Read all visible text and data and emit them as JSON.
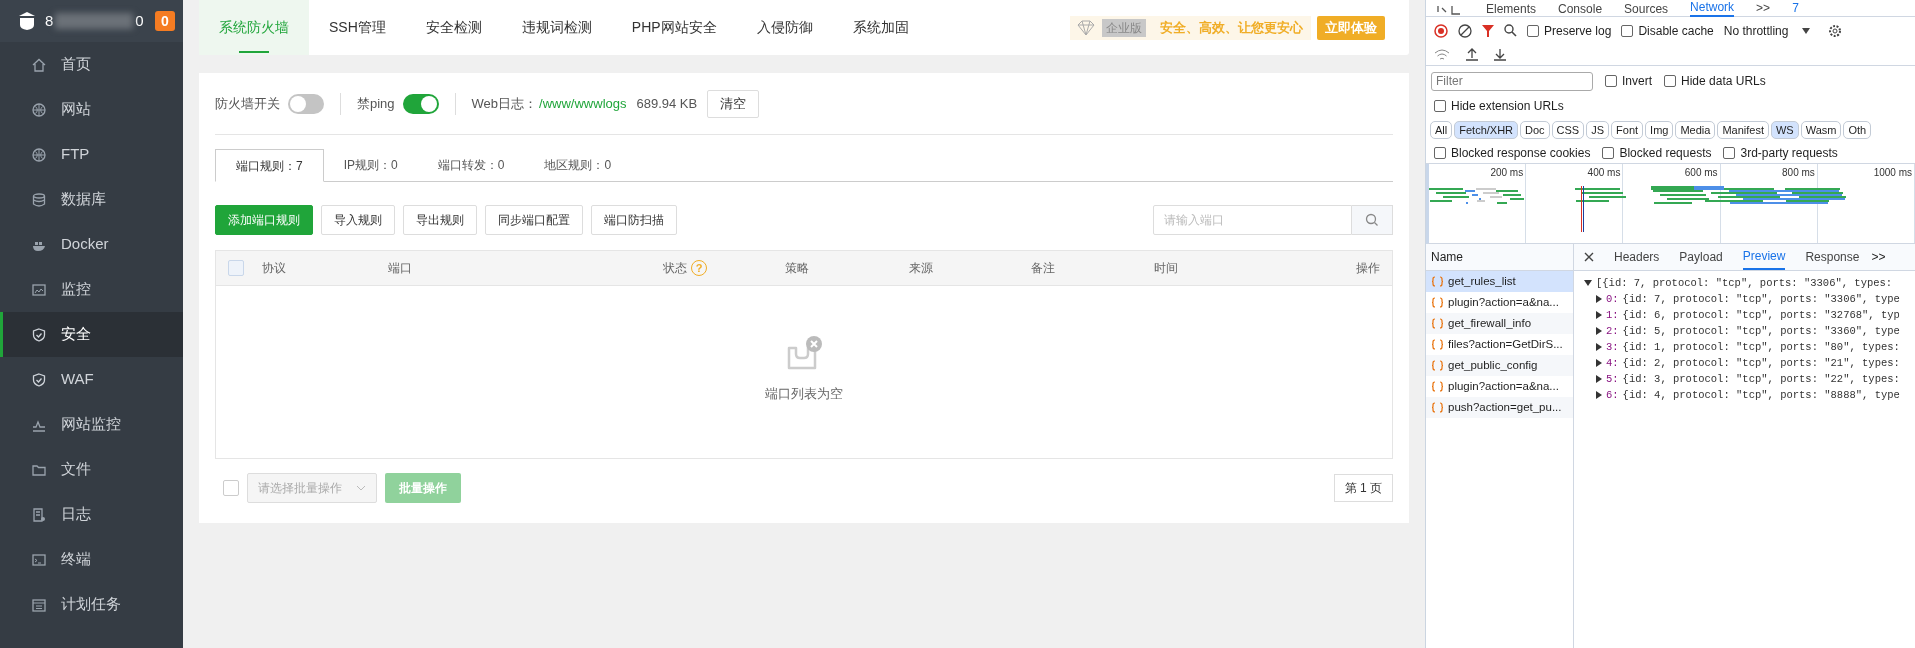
{
  "sidebar": {
    "user_start": "8",
    "user_end": "0",
    "badge": "0",
    "items": [
      {
        "label": "首页",
        "selected": false
      },
      {
        "label": "网站",
        "selected": false
      },
      {
        "label": "FTP",
        "selected": false
      },
      {
        "label": "数据库",
        "selected": false
      },
      {
        "label": "Docker",
        "selected": false
      },
      {
        "label": "监控",
        "selected": false
      },
      {
        "label": "安全",
        "selected": true
      },
      {
        "label": "WAF",
        "selected": false
      },
      {
        "label": "网站监控",
        "selected": false
      },
      {
        "label": "文件",
        "selected": false
      },
      {
        "label": "日志",
        "selected": false
      },
      {
        "label": "终端",
        "selected": false
      },
      {
        "label": "计划任务",
        "selected": false
      }
    ]
  },
  "top_tabs": [
    {
      "label": "系统防火墙",
      "selected": true
    },
    {
      "label": "SSH管理",
      "selected": false
    },
    {
      "label": "安全检测",
      "selected": false
    },
    {
      "label": "违规词检测",
      "selected": false
    },
    {
      "label": "PHP网站安全",
      "selected": false
    },
    {
      "label": "入侵防御",
      "selected": false
    },
    {
      "label": "系统加固",
      "selected": false
    }
  ],
  "promo": {
    "edition": "企业版",
    "slogan": "安全、高效、让您更安心",
    "button": "立即体验"
  },
  "firewall": {
    "switches": [
      {
        "label": "防火墙开关",
        "on": false
      },
      {
        "label": "禁ping",
        "on": true
      }
    ],
    "log_label": "Web日志：",
    "log_path": "/www/wwwlogs",
    "log_size": "689.94 KB",
    "clear_button": "清空"
  },
  "rule_tabs": [
    {
      "label": "端口规则：7",
      "selected": true
    },
    {
      "label": "IP规则：0",
      "selected": false
    },
    {
      "label": "端口转发：0",
      "selected": false
    },
    {
      "label": "地区规则：0",
      "selected": false
    }
  ],
  "toolbar_buttons": [
    {
      "label": "添加端口规则",
      "kind": "primary"
    },
    {
      "label": "导入规则",
      "kind": "default"
    },
    {
      "label": "导出规则",
      "kind": "default"
    },
    {
      "label": "同步端口配置",
      "kind": "default"
    },
    {
      "label": "端口防扫描",
      "kind": "default"
    }
  ],
  "search": {
    "placeholder": "请输入端口"
  },
  "table": {
    "select_all": false,
    "columns": [
      {
        "label": "协议"
      },
      {
        "label": "端口"
      },
      {
        "label": "状态",
        "help": "?"
      },
      {
        "label": "策略"
      },
      {
        "label": "来源"
      },
      {
        "label": "备注"
      },
      {
        "label": "时间"
      },
      {
        "label": "操作"
      }
    ],
    "empty_text": "端口列表为空"
  },
  "footer": {
    "select_all": false,
    "batch_placeholder": "请选择批量操作",
    "batch_button": "批量操作",
    "page": "第 1 页"
  },
  "devtools": {
    "tabs": [
      {
        "label": "Elements",
        "selected": false
      },
      {
        "label": "Console",
        "selected": false
      },
      {
        "label": "Sources",
        "selected": false
      },
      {
        "label": "Network",
        "selected": true
      }
    ],
    "more": ">>",
    "issues": "7",
    "checks": [
      {
        "label": "Preserve log",
        "checked": false
      },
      {
        "label": "Disable cache",
        "checked": false
      }
    ],
    "throttling": "No throttling",
    "filter_placeholder": "Filter",
    "filter_checks": [
      {
        "label": "Invert",
        "checked": false
      },
      {
        "label": "Hide data URLs",
        "checked": false
      }
    ],
    "ext_check": {
      "label": "Hide extension URLs",
      "checked": false
    },
    "type_filters": [
      {
        "label": "All",
        "selected": false
      },
      {
        "label": "Fetch/XHR",
        "selected": true
      },
      {
        "label": "Doc",
        "selected": false
      },
      {
        "label": "CSS",
        "selected": false
      },
      {
        "label": "JS",
        "selected": false
      },
      {
        "label": "Font",
        "selected": false
      },
      {
        "label": "Img",
        "selected": false
      },
      {
        "label": "Media",
        "selected": false
      },
      {
        "label": "Manifest",
        "selected": false
      },
      {
        "label": "WS",
        "selected": true
      },
      {
        "label": "Wasm",
        "selected": false
      },
      {
        "label": "Oth",
        "selected": false
      }
    ],
    "block_checks": [
      {
        "label": "Blocked response cookies",
        "checked": false
      },
      {
        "label": "Blocked requests",
        "checked": false
      },
      {
        "label": "3rd-party requests",
        "checked": false
      }
    ],
    "timeline_ticks": [
      "200 ms",
      "400 ms",
      "600 ms",
      "800 ms",
      "1000 ms"
    ],
    "name_header": "Name",
    "requests": [
      {
        "name": "get_rules_list",
        "selected": true
      },
      {
        "name": "plugin?action=a&na...",
        "selected": false
      },
      {
        "name": "get_firewall_info",
        "selected": false
      },
      {
        "name": "files?action=GetDirS...",
        "selected": false
      },
      {
        "name": "get_public_config",
        "selected": false
      },
      {
        "name": "plugin?action=a&na...",
        "selected": false
      },
      {
        "name": "push?action=get_pu...",
        "selected": false
      }
    ],
    "detail_tabs": [
      {
        "label": "Headers",
        "selected": false
      },
      {
        "label": "Payload",
        "selected": false
      },
      {
        "label": "Preview",
        "selected": true
      },
      {
        "label": "Response",
        "selected": false
      }
    ],
    "detail_more": ">>",
    "preview": {
      "summary": "[{id: 7, protocol: \"tcp\", ports: \"3306\", types:",
      "rows": [
        {
          "index": "0:",
          "text": "{id: 7, protocol: \"tcp\", ports: \"3306\", type"
        },
        {
          "index": "1:",
          "text": "{id: 6, protocol: \"tcp\", ports: \"32768\", typ"
        },
        {
          "index": "2:",
          "text": "{id: 5, protocol: \"tcp\", ports: \"3360\", type"
        },
        {
          "index": "3:",
          "text": "{id: 1, protocol: \"tcp\", ports: \"80\", types:"
        },
        {
          "index": "4:",
          "text": "{id: 2, protocol: \"tcp\", ports: \"21\", types:"
        },
        {
          "index": "5:",
          "text": "{id: 3, protocol: \"tcp\", ports: \"22\", types:"
        },
        {
          "index": "6:",
          "text": "{id: 4, protocol: \"tcp\", ports: \"8888\", type"
        }
      ]
    }
  }
}
